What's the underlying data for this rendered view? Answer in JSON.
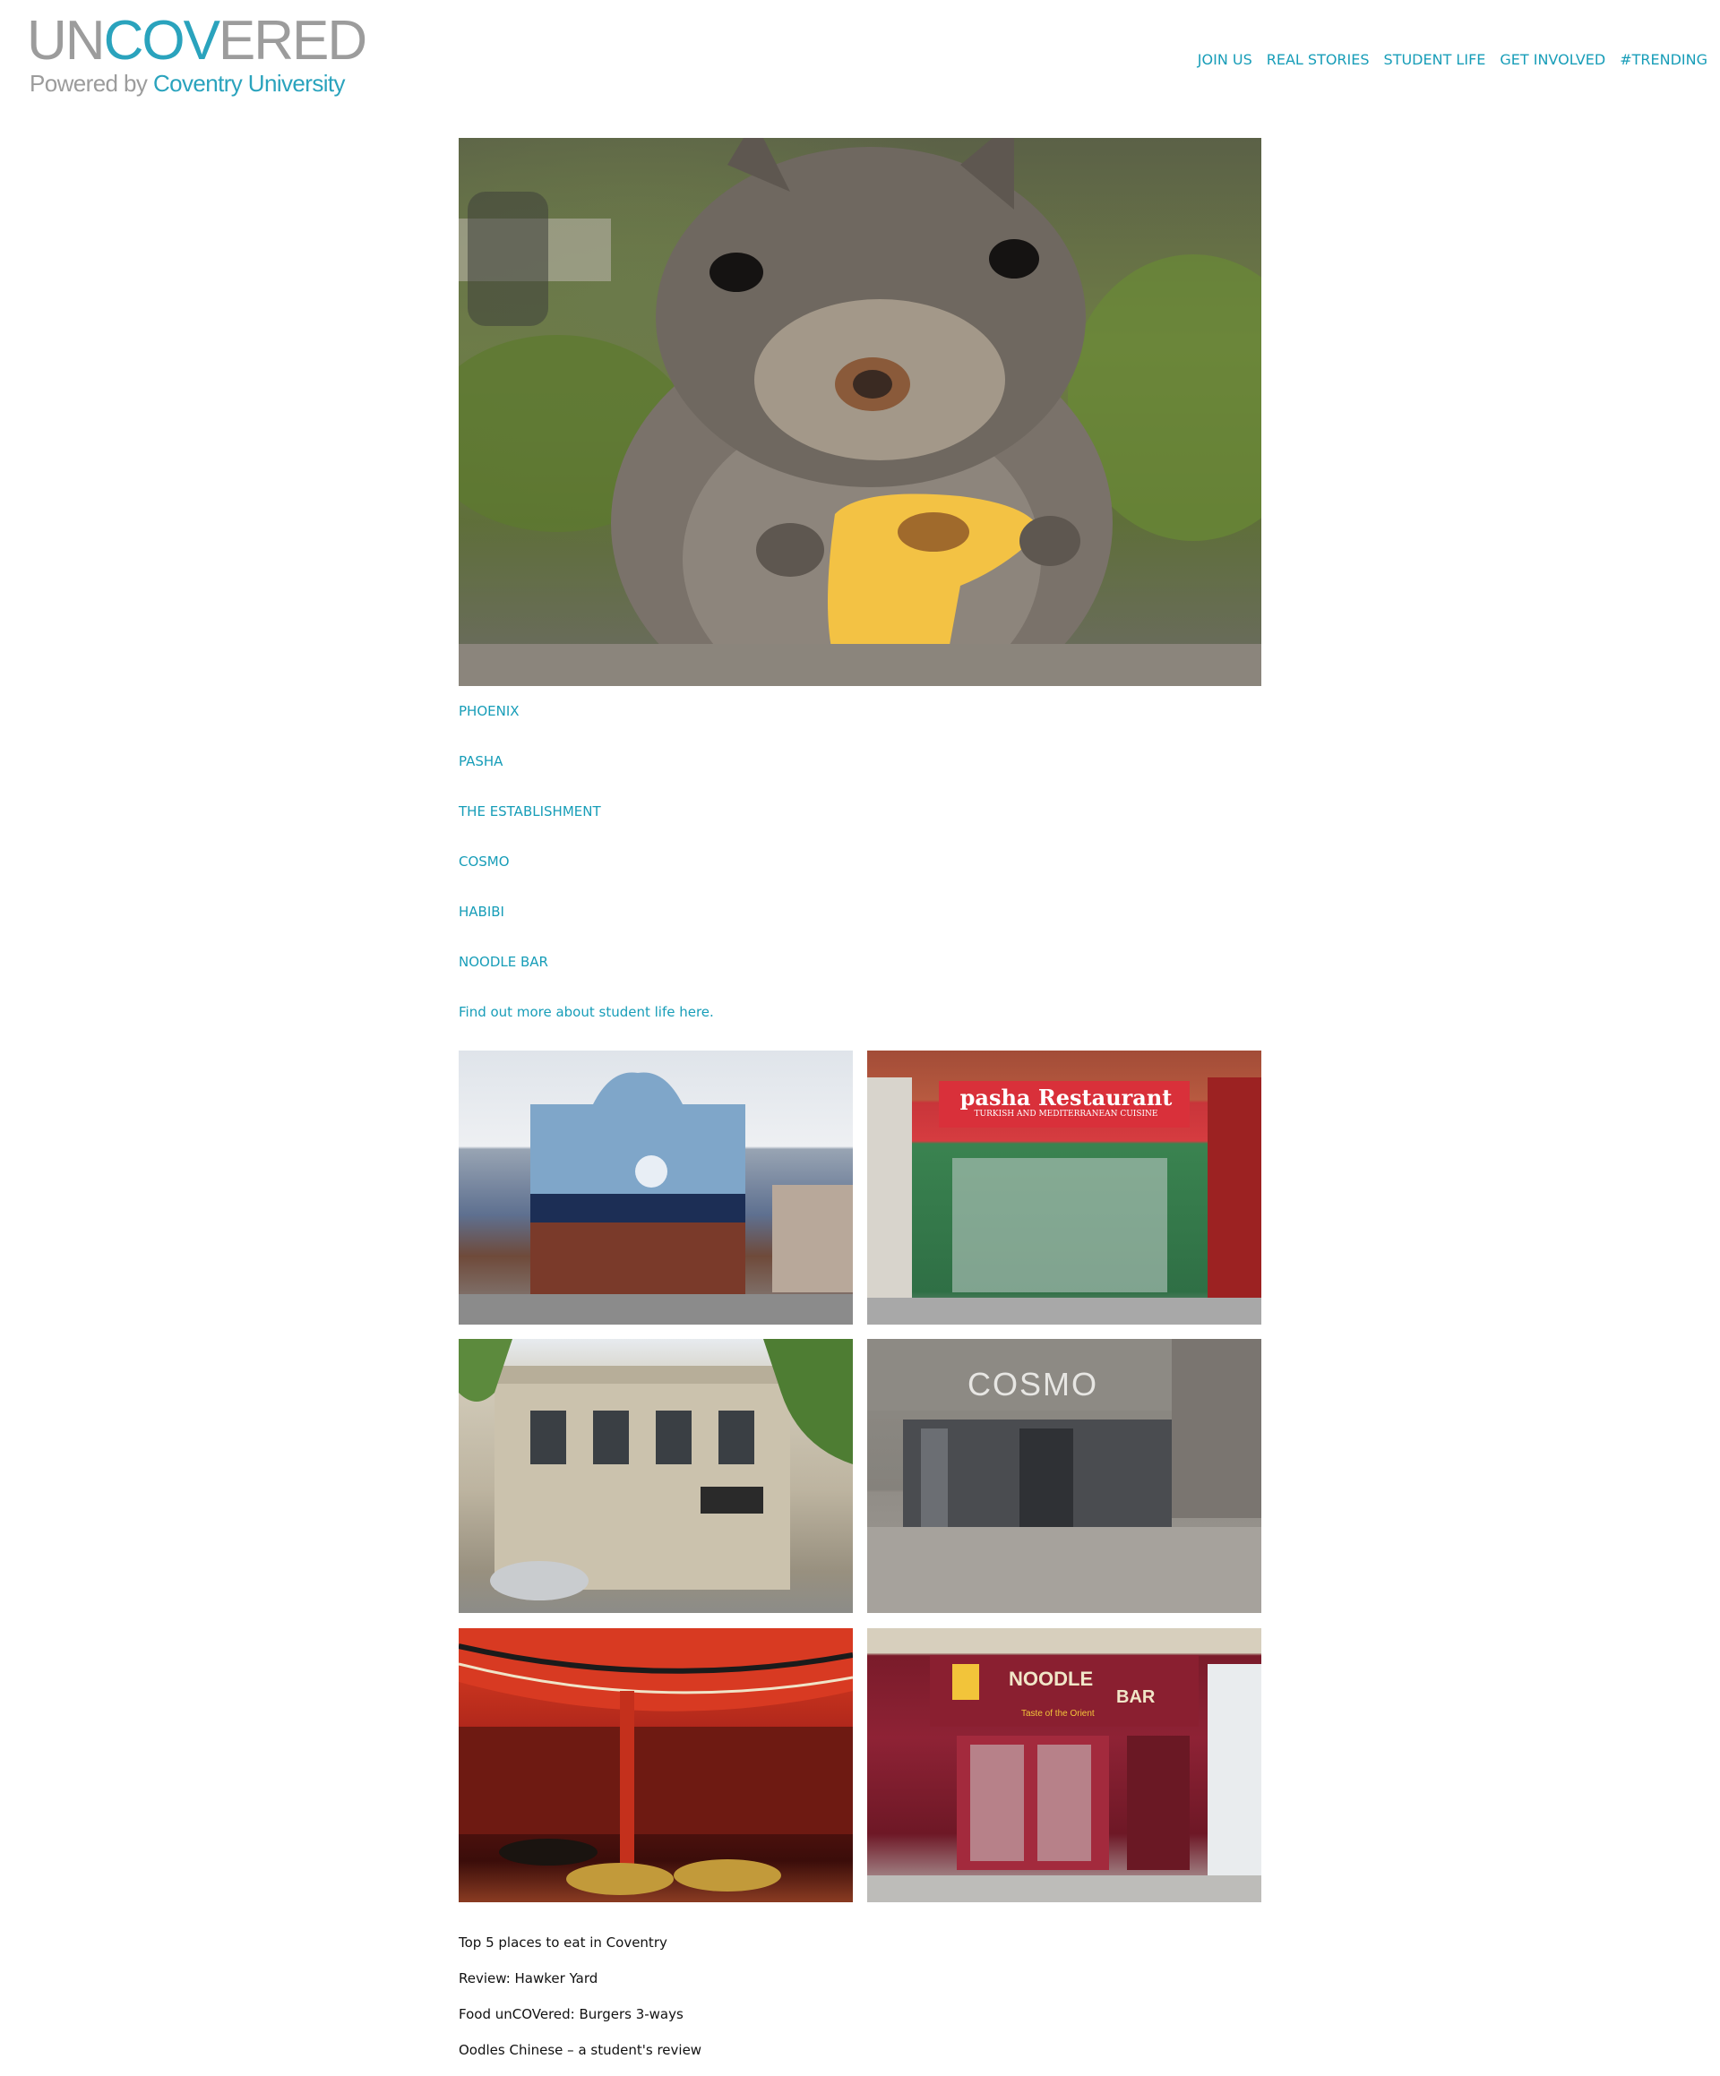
{
  "logo": {
    "part1": "UN",
    "part2": "COV",
    "part3": "ERED",
    "tagline_prefix": "Powered by",
    "tagline_brand": "Coventry University"
  },
  "nav": {
    "items": [
      "JOIN US",
      "REAL STORIES",
      "STUDENT LIFE",
      "GET INVOLVED",
      "#TRENDING"
    ]
  },
  "restaurant_links": [
    "PHOENIX",
    "PASHA",
    "THE ESTABLISHMENT",
    "COSMO",
    "HABIBI",
    "NOODLE BAR"
  ],
  "more_link": "Find out more about student life here.",
  "photos": {
    "pasha_sign": "pasha Restaurant",
    "pasha_sub": "TURKISH AND MEDITERRANEAN CUISINE",
    "cosmo_sign": "COSMO",
    "noodle_sign1": "NOODLE",
    "noodle_sign2": "BAR",
    "noodle_sign3": "Taste of the Orient"
  },
  "related_posts": [
    "Top 5 places to eat in Coventry",
    "Review: Hawker Yard",
    "Food unCOVered: Burgers 3-ways",
    "Oodles Chinese – a student's review"
  ],
  "colors": {
    "accent": "#179db8",
    "logo_grey": "#9c9c9c",
    "logo_teal": "#2aa3bd"
  }
}
